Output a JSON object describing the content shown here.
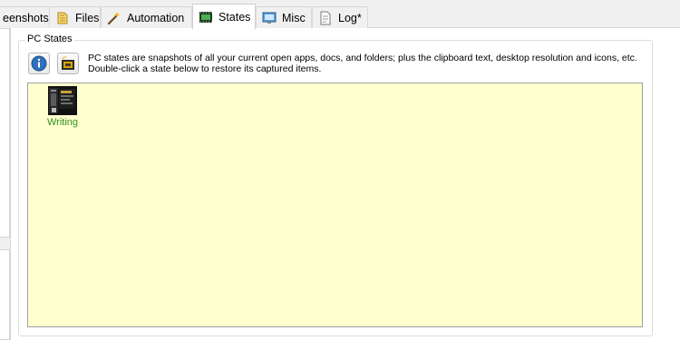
{
  "tabs": [
    {
      "label": "eenshots",
      "icon": "screenshots-icon",
      "active": false
    },
    {
      "label": "Files",
      "icon": "files-icon",
      "active": false
    },
    {
      "label": "Automation",
      "icon": "magic-wand-icon",
      "active": false
    },
    {
      "label": "States",
      "icon": "film-strip-icon",
      "active": true
    },
    {
      "label": "Misc",
      "icon": "monitor-icon",
      "active": false
    },
    {
      "label": "Log*",
      "icon": "document-icon",
      "active": false
    }
  ],
  "pc_states": {
    "group_label": "PC States",
    "info_button_icon": "info-icon",
    "capture_button_icon": "capture-state-icon",
    "description_line1": "PC states are snapshots of all your current open apps, docs, and folders; plus the clipboard text, desktop resolution and icons, etc.",
    "description_line2": "Double-click a state below to restore its captured items.",
    "area_color": "#ffffcf",
    "items": [
      {
        "label": "Writing",
        "icon": "writing-state-thumbnail-icon",
        "label_color": "#2f8f1f"
      }
    ]
  }
}
